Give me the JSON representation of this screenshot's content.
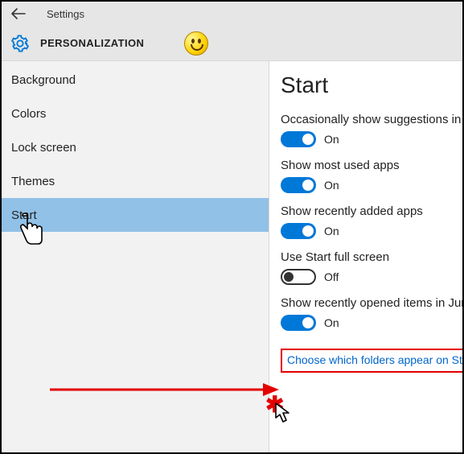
{
  "header": {
    "title": "Settings",
    "category": "PERSONALIZATION"
  },
  "sidebar": {
    "items": [
      {
        "label": "Background"
      },
      {
        "label": "Colors"
      },
      {
        "label": "Lock screen"
      },
      {
        "label": "Themes"
      },
      {
        "label": "Start"
      }
    ],
    "selectedIndex": 4
  },
  "main": {
    "title": "Start",
    "settings": [
      {
        "label": "Occasionally show suggestions in Start",
        "on": true,
        "stateText": "On"
      },
      {
        "label": "Show most used apps",
        "on": true,
        "stateText": "On"
      },
      {
        "label": "Show recently added apps",
        "on": true,
        "stateText": "On"
      },
      {
        "label": "Use Start full screen",
        "on": false,
        "stateText": "Off"
      },
      {
        "label": "Show recently opened items in Jump Lists",
        "on": true,
        "stateText": "On"
      }
    ],
    "link": "Choose which folders appear on Start"
  },
  "colors": {
    "accent": "#0078d7",
    "highlightBorder": "#e30000"
  }
}
